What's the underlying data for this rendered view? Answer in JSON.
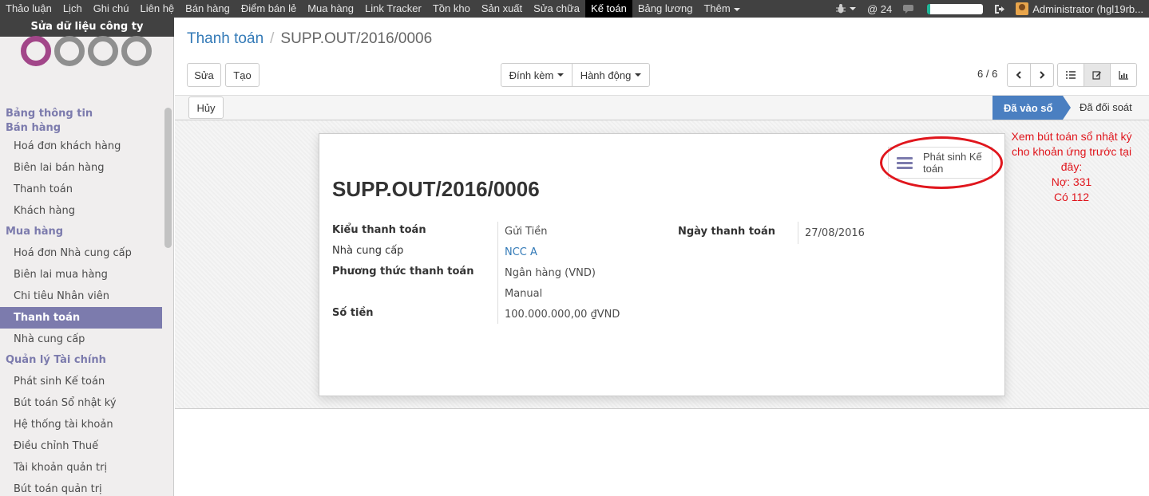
{
  "topbar": {
    "menu": [
      "Thảo luận",
      "Lịch",
      "Ghi chú",
      "Liên hệ",
      "Bán hàng",
      "Điểm bán lẻ",
      "Mua hàng",
      "Link Tracker",
      "Tồn kho",
      "Sản xuất",
      "Sửa chữa",
      "Kế toán",
      "Bảng lương",
      "Thêm"
    ],
    "active_index": 11,
    "mentions": "@ 24",
    "user": "Administrator (hgl19rb..."
  },
  "sidebar": {
    "company_button": "Sửa dữ liệu công ty",
    "sections": [
      {
        "title": "Bảng thông tin",
        "items": []
      },
      {
        "title": "Bán hàng",
        "items": [
          "Hoá đơn khách hàng",
          "Biên lai bán hàng",
          "Thanh toán",
          "Khách hàng"
        ]
      },
      {
        "title": "Mua hàng",
        "items": [
          "Hoá đơn Nhà cung cấp",
          "Biên lai mua hàng",
          "Chi tiêu Nhân viên",
          "Thanh toán",
          "Nhà cung cấp"
        ]
      },
      {
        "title": "Quản lý Tài chính",
        "items": [
          "Phát sinh Kế toán",
          "Bút toán Sổ nhật ký",
          "Hệ thống tài khoản",
          "Điều chỉnh Thuế",
          "Tài khoản quản trị",
          "Bút toán quản trị"
        ]
      }
    ]
  },
  "breadcrumb": {
    "parent": "Thanh toán",
    "separator": "/",
    "current": "SUPP.OUT/2016/0006"
  },
  "buttons": {
    "edit": "Sửa",
    "create": "Tạo",
    "attach": "Đính kèm",
    "action": "Hành động",
    "cancel": "Hủy"
  },
  "pager": "6 / 6",
  "status": {
    "active": "Đã vào sổ",
    "next": "Đã đối soát"
  },
  "smart_button": {
    "line1": "Phát sinh Kế",
    "line2": "toán"
  },
  "record": {
    "title": "SUPP.OUT/2016/0006",
    "fields": {
      "payment_type_label": "Kiểu thanh toán",
      "payment_type_value": "Gửi Tiền",
      "partner_label": "Nhà cung cấp",
      "partner_value": "NCC A",
      "journal_label": "Phương thức thanh toán",
      "journal_value": "Ngân hàng (VND)",
      "method_value": "Manual",
      "amount_label": "Số tiền",
      "amount_value": "100.000.000,00 ₫VND",
      "date_label": "Ngày thanh toán",
      "date_value": "27/08/2016"
    }
  },
  "annotation": [
    "Xem bút toán sổ nhật ký",
    "cho khoản ứng trước tại",
    "đây:",
    "Nợ: 331",
    "Có 112"
  ],
  "colors": {
    "accent": "#7c7bad",
    "status_active": "#4a7fc1",
    "annotation": "#e0161d",
    "link": "#337ab7"
  }
}
